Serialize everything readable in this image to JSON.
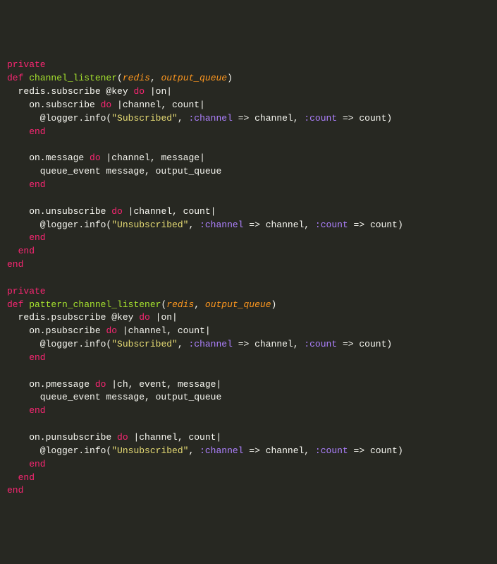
{
  "l1": {
    "private": "private"
  },
  "l2": {
    "def": "def",
    "name": "channel_listener",
    "p1": "redis",
    "p2": "output_queue"
  },
  "l3": {
    "t": "  redis.subscribe @key ",
    "do": "do",
    "pipe": " |on|"
  },
  "l4": {
    "t1": "    on.subscribe ",
    "do": "do",
    "pipe": " |channel, count|"
  },
  "l5": {
    "t1": "      @logger.info(",
    "str": "\"Subscribed\"",
    "t2": ", ",
    "s1": ":channel",
    "op1": " => ",
    "v1": "channel, ",
    "s2": ":count",
    "op2": " => ",
    "v2": "count)"
  },
  "l6": {
    "end": "    end"
  },
  "l7": {
    "blank": ""
  },
  "l8": {
    "t1": "    on.message ",
    "do": "do",
    "pipe": " |channel, message|"
  },
  "l9": {
    "t": "      queue_event message, output_queue"
  },
  "l10": {
    "end": "    end"
  },
  "l11": {
    "blank": ""
  },
  "l12": {
    "t1": "    on.unsubscribe ",
    "do": "do",
    "pipe": " |channel, count|"
  },
  "l13": {
    "t1": "      @logger.info(",
    "str": "\"Unsubscribed\"",
    "t2": ", ",
    "s1": ":channel",
    "op1": " => ",
    "v1": "channel, ",
    "s2": ":count",
    "op2": " => ",
    "v2": "count)"
  },
  "l14": {
    "end": "    end"
  },
  "l15": {
    "end": "  end"
  },
  "l16": {
    "end": "end"
  },
  "l17": {
    "blank": ""
  },
  "l18": {
    "private": "private"
  },
  "l19": {
    "def": "def",
    "name": "pattern_channel_listener",
    "p1": "redis",
    "p2": "output_queue"
  },
  "l20": {
    "t": "  redis.psubscribe @key ",
    "do": "do",
    "pipe": " |on|"
  },
  "l21": {
    "t1": "    on.psubscribe ",
    "do": "do",
    "pipe": " |channel, count|"
  },
  "l22": {
    "t1": "      @logger.info(",
    "str": "\"Subscribed\"",
    "t2": ", ",
    "s1": ":channel",
    "op1": " => ",
    "v1": "channel, ",
    "s2": ":count",
    "op2": " => ",
    "v2": "count)"
  },
  "l23": {
    "end": "    end"
  },
  "l24": {
    "blank": ""
  },
  "l25": {
    "t1": "    on.pmessage ",
    "do": "do",
    "pipe": " |ch, event, message|"
  },
  "l26": {
    "t": "      queue_event message, output_queue"
  },
  "l27": {
    "end": "    end"
  },
  "l28": {
    "blank": ""
  },
  "l29": {
    "t1": "    on.punsubscribe ",
    "do": "do",
    "pipe": " |channel, count|"
  },
  "l30": {
    "t1": "      @logger.info(",
    "str": "\"Unsubscribed\"",
    "t2": ", ",
    "s1": ":channel",
    "op1": " => ",
    "v1": "channel, ",
    "s2": ":count",
    "op2": " => ",
    "v2": "count)"
  },
  "l31": {
    "end": "    end"
  },
  "l32": {
    "end": "  end"
  },
  "l33": {
    "end": "end"
  }
}
